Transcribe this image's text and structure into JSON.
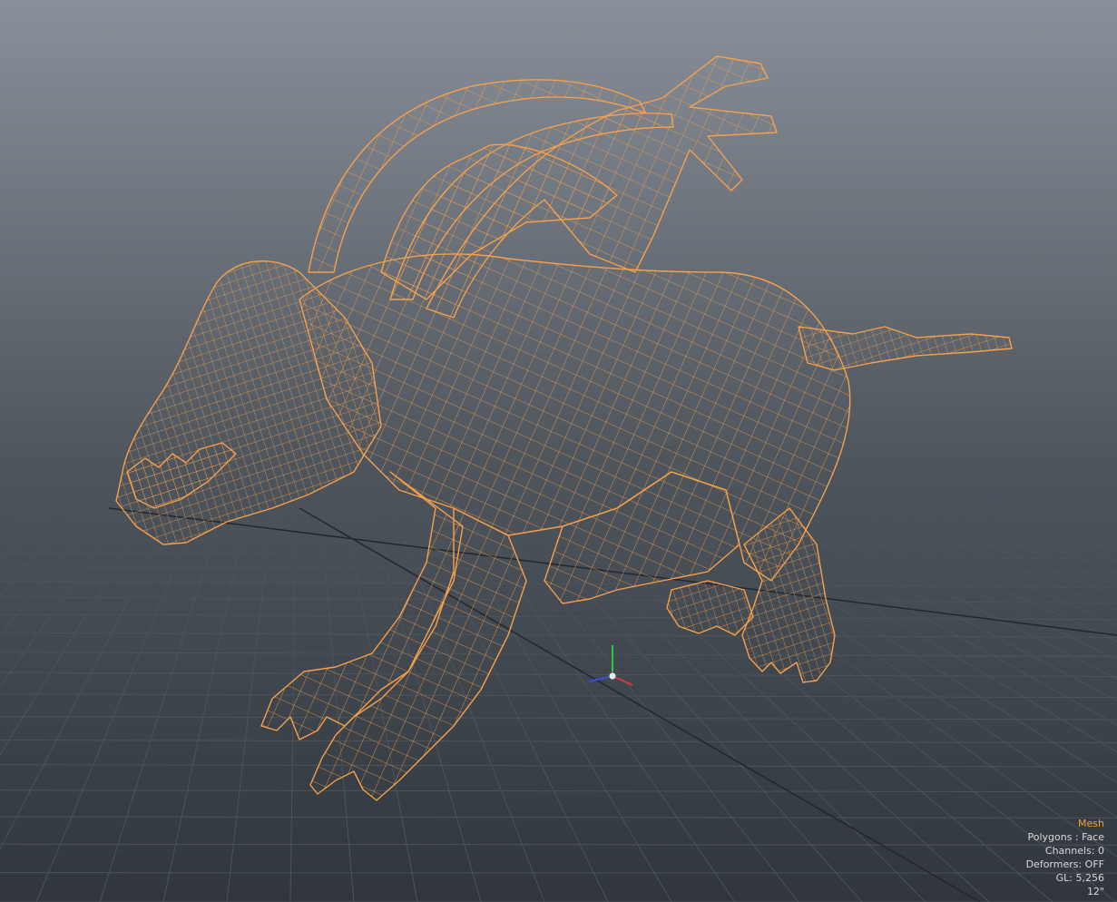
{
  "viewport": {
    "selection_type": "Mesh",
    "info_lines": [
      "Polygons : Face",
      "Channels: 0",
      "Deformers: OFF",
      "GL: 5,256",
      "12\""
    ]
  },
  "colors": {
    "background_top": "#8a9099",
    "background_bottom": "#30363c",
    "grid_line": "#4b535c",
    "wireframe": "#f5a04c",
    "mesh_fill": "#000000",
    "axis_x": "#d23a3a",
    "axis_y": "#34c24a",
    "axis_z": "#3a4fd8",
    "hud_title": "#f0a23c",
    "hud_text": "#d8d8d8"
  },
  "icons": {
    "gizmo": "world-axis-gizmo-icon"
  }
}
